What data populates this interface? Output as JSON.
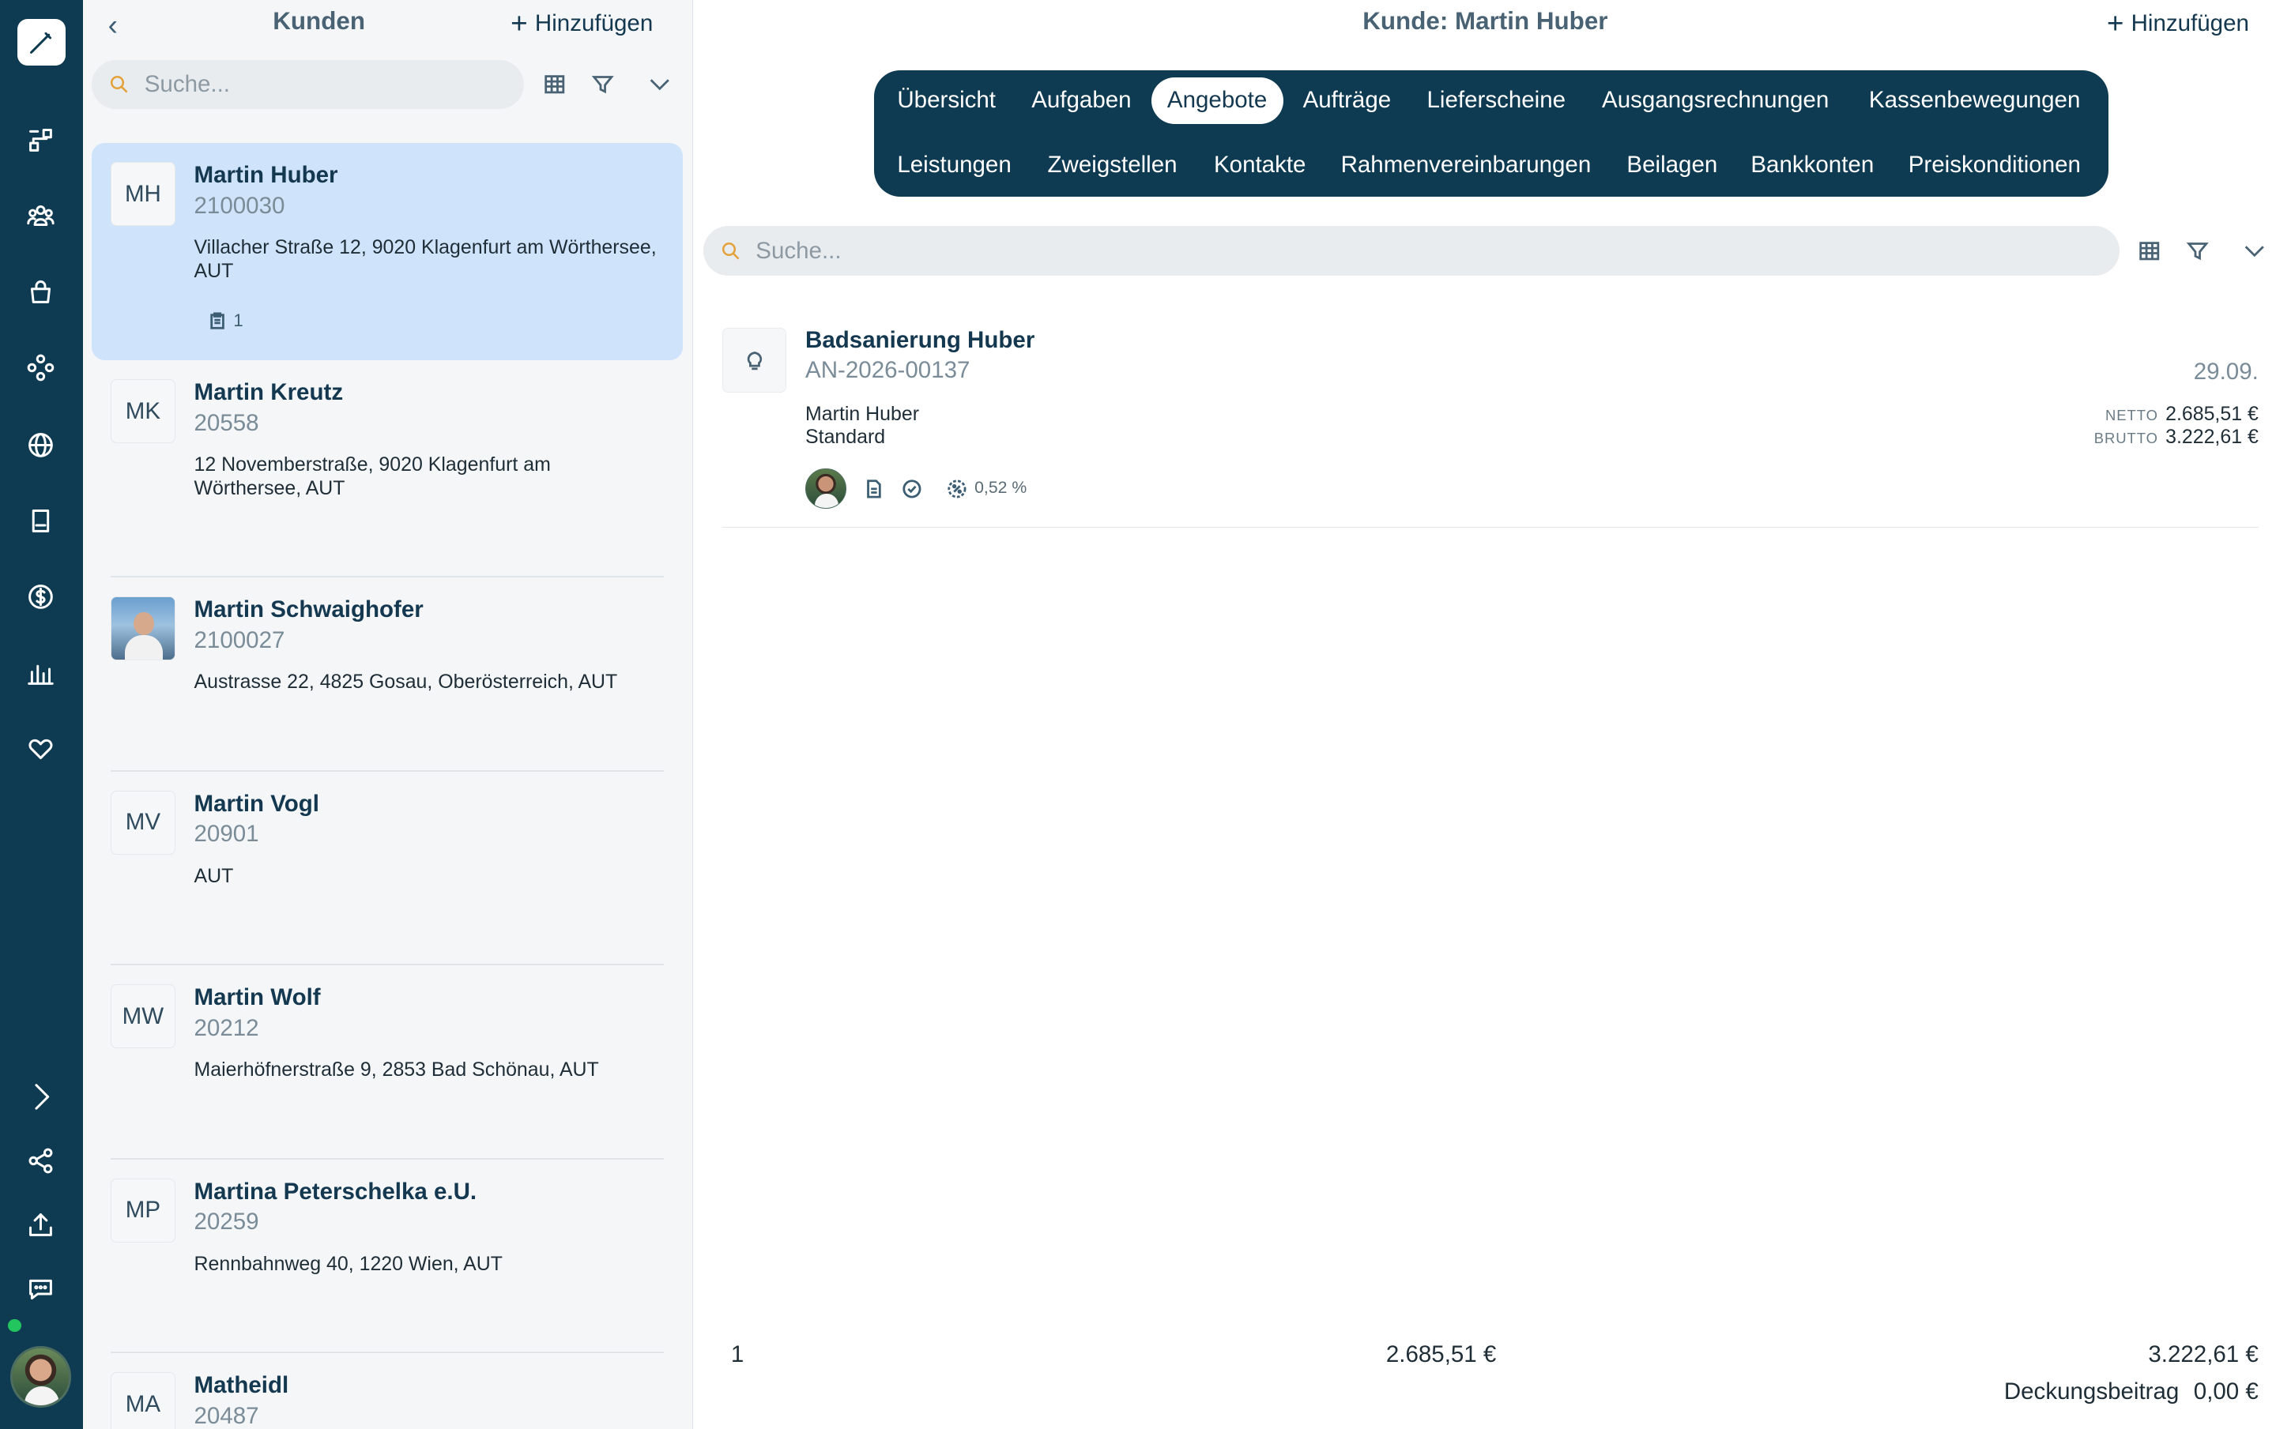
{
  "rail": {
    "icons": [
      "pen-logo-icon",
      "flow-icon",
      "users-icon",
      "bag-icon",
      "network-icon",
      "globe-icon",
      "book-icon",
      "dollar-icon",
      "chart-icon",
      "heart-icon"
    ],
    "bottom_icons": [
      "chevron-right-icon",
      "share-icon",
      "upload-icon",
      "chat-icon"
    ]
  },
  "left": {
    "title": "Kunden",
    "add_label": "Hinzufügen",
    "search_placeholder": "Suche...",
    "customers": [
      {
        "initials": "MH",
        "name": "Martin Huber",
        "number": "2100030",
        "address": "Villacher Straße 12, 9020 Klagenfurt am Wörthersee, AUT",
        "badge": "1",
        "selected": true
      },
      {
        "initials": "MK",
        "name": "Martin Kreutz",
        "number": "20558",
        "address": "12 Novemberstraße, 9020 Klagenfurt am Wörthersee, AUT"
      },
      {
        "initials": "",
        "name": "Martin Schwaighofer",
        "number": "2100027",
        "address": "Austrasse 22, 4825 Gosau, Oberösterreich, AUT",
        "photo": true
      },
      {
        "initials": "MV",
        "name": "Martin Vogl",
        "number": "20901",
        "address": "AUT"
      },
      {
        "initials": "MW",
        "name": "Martin Wolf",
        "number": "20212",
        "address": "Maierhöfnerstraße 9, 2853 Bad Schönau, AUT"
      },
      {
        "initials": "MP",
        "name": "Martina Peterschelka e.U.",
        "number": "20259",
        "address": "Rennbahnweg 40, 1220 Wien, AUT"
      },
      {
        "initials": "MA",
        "name": "Matheidl",
        "number": "20487",
        "address": ""
      }
    ]
  },
  "main": {
    "title": "Kunde: Martin Huber",
    "add_label": "Hinzufügen",
    "tabs_row1": [
      "Übersicht",
      "Aufgaben",
      "Angebote",
      "Aufträge",
      "Lieferscheine",
      "Ausgangsrechnungen",
      "Kassenbewegungen"
    ],
    "tabs_row2": [
      "Leistungen",
      "Zweigstellen",
      "Kontakte",
      "Rahmenvereinbarungen",
      "Beilagen",
      "Bankkonten",
      "Preiskonditionen"
    ],
    "active_tab": "Angebote",
    "search_placeholder": "Suche...",
    "offer": {
      "name": "Badsanierung Huber",
      "number": "AN-2026-00137",
      "date": "29.09.",
      "customer": "Martin Huber",
      "type": "Standard",
      "netto_label": "NETTO",
      "netto": "2.685,51 €",
      "brutto_label": "BRUTTO",
      "brutto": "3.222,61 €",
      "percent": "0,52 %"
    },
    "footer": {
      "count": "1",
      "netto_total": "2.685,51 €",
      "brutto_total": "3.222,61 €",
      "margin_label": "Deckungsbeitrag",
      "margin_value": "0,00 €"
    }
  }
}
